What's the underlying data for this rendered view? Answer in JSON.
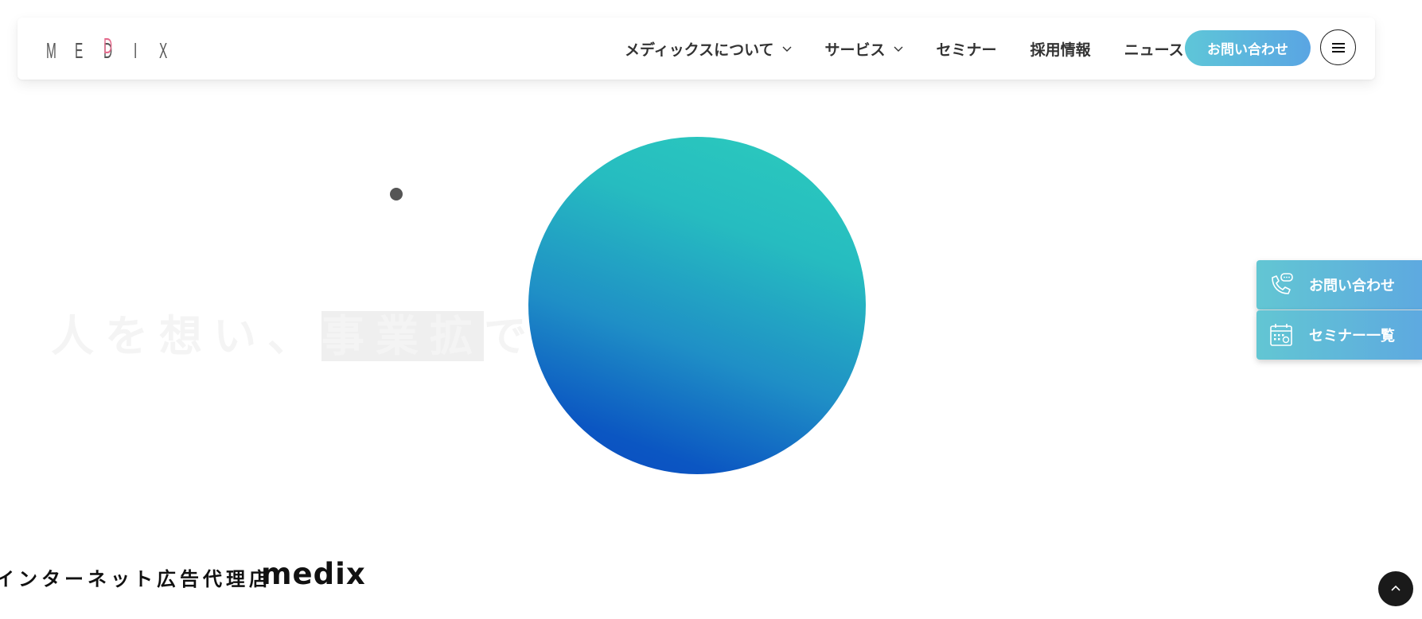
{
  "header": {
    "logo_letters": [
      "M",
      "E",
      "D",
      "I",
      "X"
    ],
    "nav": [
      {
        "label": "メディックスについて",
        "has_dropdown": true
      },
      {
        "label": "サービス",
        "has_dropdown": true
      },
      {
        "label": "セミナー",
        "has_dropdown": false
      },
      {
        "label": "採用情報",
        "has_dropdown": false
      },
      {
        "label": "ニュース",
        "has_dropdown": false
      }
    ],
    "contact_label": "お問い合わせ",
    "menu_icon": "hamburger-icon"
  },
  "hero": {
    "text_before": "人を想い、",
    "text_highlight": "事業拡",
    "text_after": "でつ",
    "circle_colors": [
      "#2cccbd",
      "#0a4ac0"
    ]
  },
  "side_tabs": [
    {
      "label": "お問い合わせ",
      "icon": "phone-chat-icon"
    },
    {
      "label": "セミナー一覧",
      "icon": "calendar-icon"
    }
  ],
  "footer": {
    "tagline": "インターネット広告代理店",
    "brand": "medix"
  },
  "colors": {
    "accent_start": "#5ec6d8",
    "accent_end": "#5aa5e3",
    "logo_pink": "#e46a8c"
  }
}
